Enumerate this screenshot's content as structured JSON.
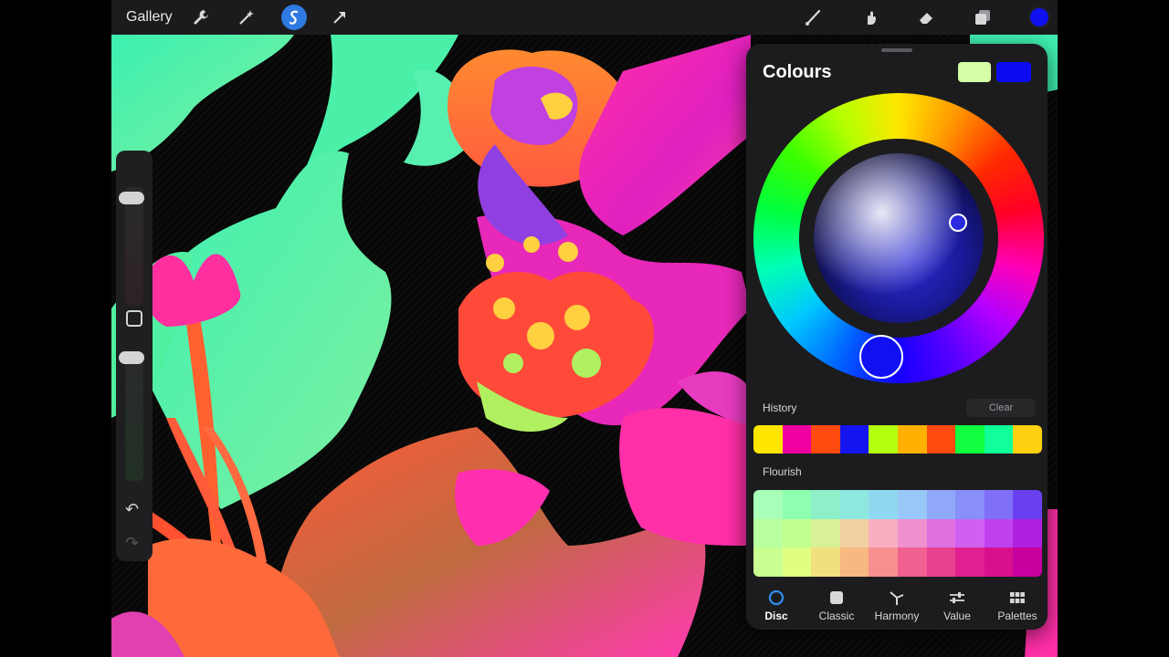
{
  "toolbar": {
    "gallery_label": "Gallery",
    "left_tools": [
      "wrench-icon",
      "magic-wand-icon",
      "selection-icon",
      "transform-arrow-icon"
    ],
    "right_tools": [
      "brush-icon",
      "smudge-icon",
      "eraser-icon",
      "layers-icon"
    ],
    "active_color": "#1010f0"
  },
  "sidebar": {
    "brush_size_level": 0.2,
    "opacity_level": 0.05
  },
  "colours_panel": {
    "title": "Colours",
    "primary_swatch": "#d4ffa8",
    "secondary_swatch": "#0b0bf2",
    "current_hue": "#1010f2",
    "history_label": "History",
    "clear_label": "Clear",
    "history_colors": [
      "#ffe600",
      "#f000a0",
      "#ff4a10",
      "#1414f0",
      "#b4ff10",
      "#ffb000",
      "#ff4a10",
      "#10ff40",
      "#10ff9a",
      "#ffd010"
    ],
    "flourish_label": "Flourish",
    "flourish_colors": [
      "#a8ffb8",
      "#8effb0",
      "#8ef0c8",
      "#8ee8e0",
      "#90d8f0",
      "#98c8f8",
      "#90a8f8",
      "#8890f8",
      "#8070f8",
      "#6a40f0",
      "#b8ffa0",
      "#c0ff90",
      "#d8f098",
      "#f0d0a0",
      "#f8b0c0",
      "#f090d0",
      "#e070e0",
      "#d060f0",
      "#c040f0",
      "#b020e0",
      "#c8ff90",
      "#e0ff80",
      "#f0e080",
      "#f8b880",
      "#f89090",
      "#f06090",
      "#e84090",
      "#e02090",
      "#d81090",
      "#c800a0"
    ],
    "tabs": [
      {
        "label": "Disc",
        "icon": "circle-icon",
        "active": true
      },
      {
        "label": "Classic",
        "icon": "square-icon",
        "active": false
      },
      {
        "label": "Harmony",
        "icon": "harmony-icon",
        "active": false
      },
      {
        "label": "Value",
        "icon": "sliders-icon",
        "active": false
      },
      {
        "label": "Palettes",
        "icon": "grid-icon",
        "active": false
      }
    ]
  }
}
